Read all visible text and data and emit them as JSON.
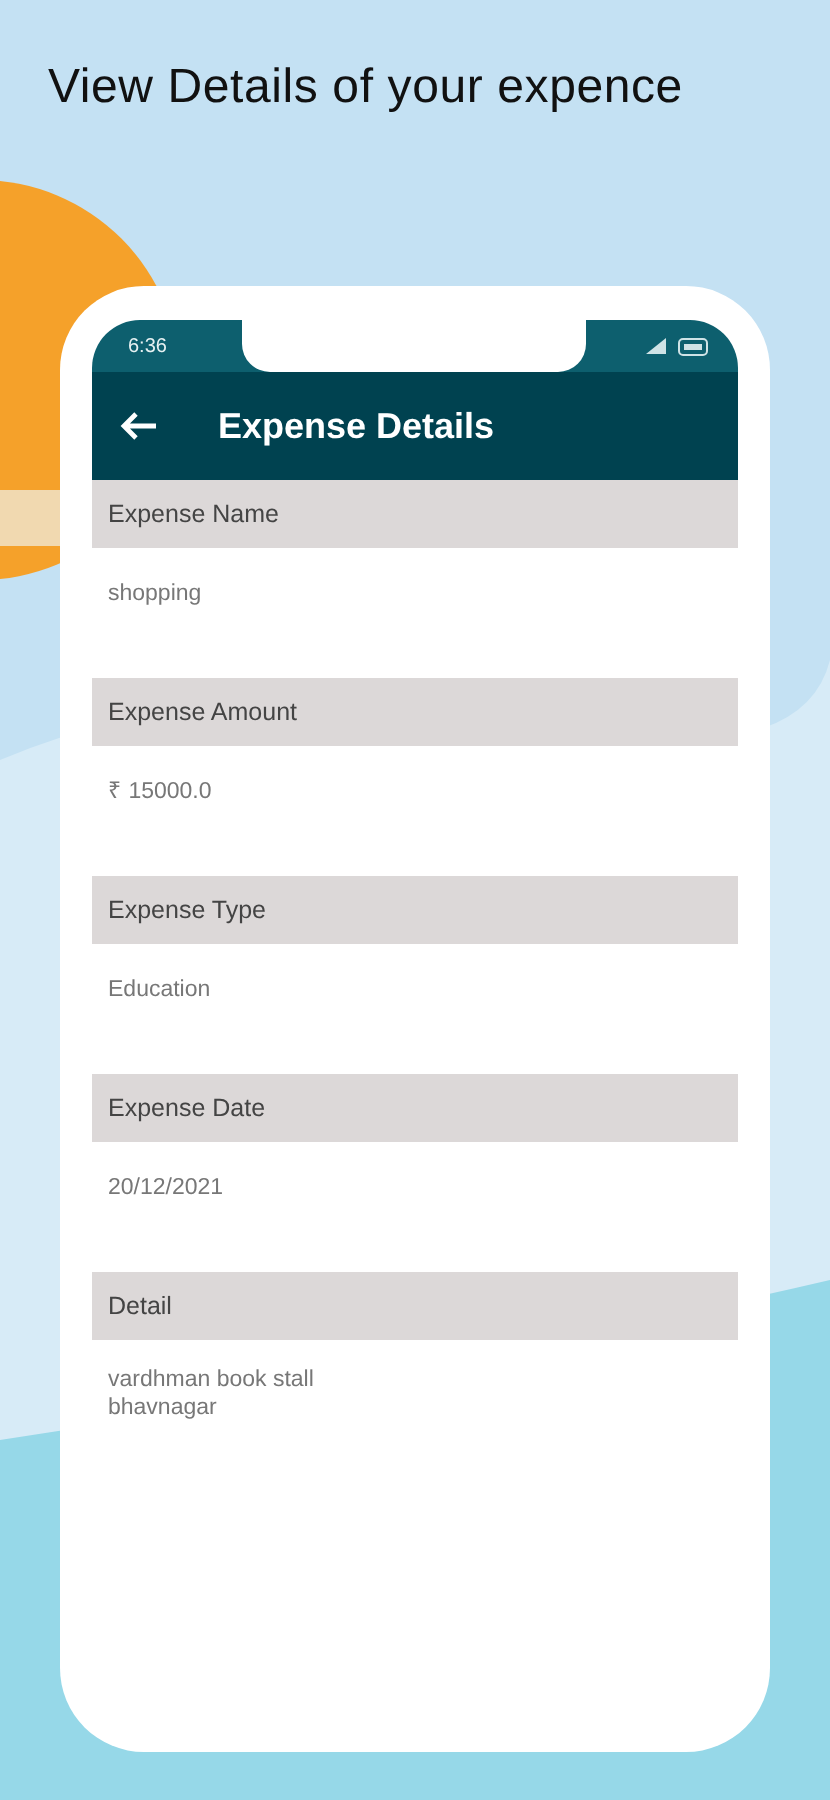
{
  "headline": "View Details of your expence",
  "status_bar": {
    "time": "6:36"
  },
  "app_bar": {
    "title": "Expense Details"
  },
  "fields": [
    {
      "label": "Expense Name",
      "value": "shopping"
    },
    {
      "label": "Expense Amount",
      "value": "₹ 15000.0"
    },
    {
      "label": "Expense Type",
      "value": "Education"
    },
    {
      "label": "Expense Date",
      "value": "20/12/2021"
    },
    {
      "label": "Detail",
      "value": "vardhman book stall\nbhavnagar"
    }
  ]
}
